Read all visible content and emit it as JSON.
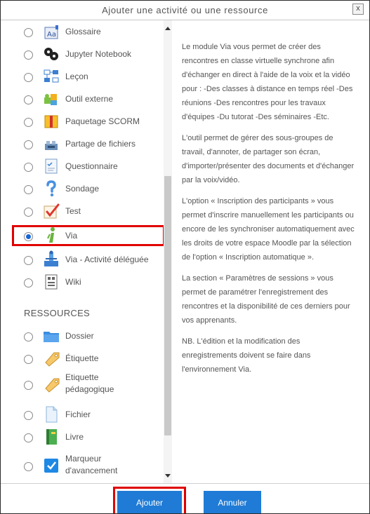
{
  "dialog": {
    "title": "Ajouter une activité ou une ressource",
    "close_label": "x"
  },
  "activities": [
    {
      "label": "Glossaire",
      "icon": "glossary-icon",
      "checked": false
    },
    {
      "label": "Jupyter Notebook",
      "icon": "jupyter-icon",
      "checked": false
    },
    {
      "label": "Leçon",
      "icon": "lesson-icon",
      "checked": false
    },
    {
      "label": "Outil externe",
      "icon": "external-tool-icon",
      "checked": false
    },
    {
      "label": "Paquetage SCORM",
      "icon": "scorm-icon",
      "checked": false
    },
    {
      "label": "Partage de fichiers",
      "icon": "file-share-icon",
      "checked": false
    },
    {
      "label": "Questionnaire",
      "icon": "questionnaire-icon",
      "checked": false
    },
    {
      "label": "Sondage",
      "icon": "survey-icon",
      "checked": false
    },
    {
      "label": "Test",
      "icon": "test-icon",
      "checked": false
    },
    {
      "label": "Via",
      "icon": "via-icon",
      "checked": true
    },
    {
      "label": "Via - Activité déléguée",
      "icon": "via-delegated-icon",
      "checked": false
    },
    {
      "label": "Wiki",
      "icon": "wiki-icon",
      "checked": false
    }
  ],
  "resources_heading": "RESSOURCES",
  "resources": [
    {
      "label": "Dossier",
      "icon": "folder-icon",
      "checked": false
    },
    {
      "label": "Étiquette",
      "icon": "label-icon",
      "checked": false
    },
    {
      "label": "Etiquette pédagogique",
      "label_line1": "Etiquette",
      "label_line2": "pédagogique",
      "icon": "pedagogical-label-icon",
      "checked": false
    },
    {
      "label": "Fichier",
      "icon": "file-icon",
      "checked": false
    },
    {
      "label": "Livre",
      "icon": "book-icon",
      "checked": false
    },
    {
      "label": "Marqueur d'avancement",
      "label_line1": "Marqueur",
      "label_line2": "d'avancement",
      "icon": "progress-marker-icon",
      "checked": false
    }
  ],
  "description": [
    "Le module Via vous permet de créer des rencontres en classe virtuelle synchrone afin d'échanger en direct à l'aide de la voix et la vidéo pour : -Des classes à distance en temps réel -Des réunions -Des rencontres pour les travaux d'équipes -Du tutorat -Des séminaires -Etc.",
    "L'outil permet de gérer des sous-groupes de travail, d'annoter, de partager son écran, d'importer/présenter des documents et d'échanger par la voix/vidéo.",
    "L'option « Inscription des participants » vous permet d'inscrire manuellement les participants ou encore de les synchroniser automatiquement avec les droits de votre espace Moodle par la sélection de l'option « Inscription automatique ».",
    "La section « Paramètres de sessions » vous permet de paramétrer l'enregistrement des rencontres et la disponibilité de ces derniers pour vos apprenants.",
    "NB. L'édition et la modification des enregistrements doivent se faire dans l'environnement Via."
  ],
  "buttons": {
    "add": "Ajouter",
    "cancel": "Annuler"
  },
  "colors": {
    "primary_button": "#1f7bd6",
    "highlight": "#e00000",
    "selected_radio": "#1565d8"
  }
}
